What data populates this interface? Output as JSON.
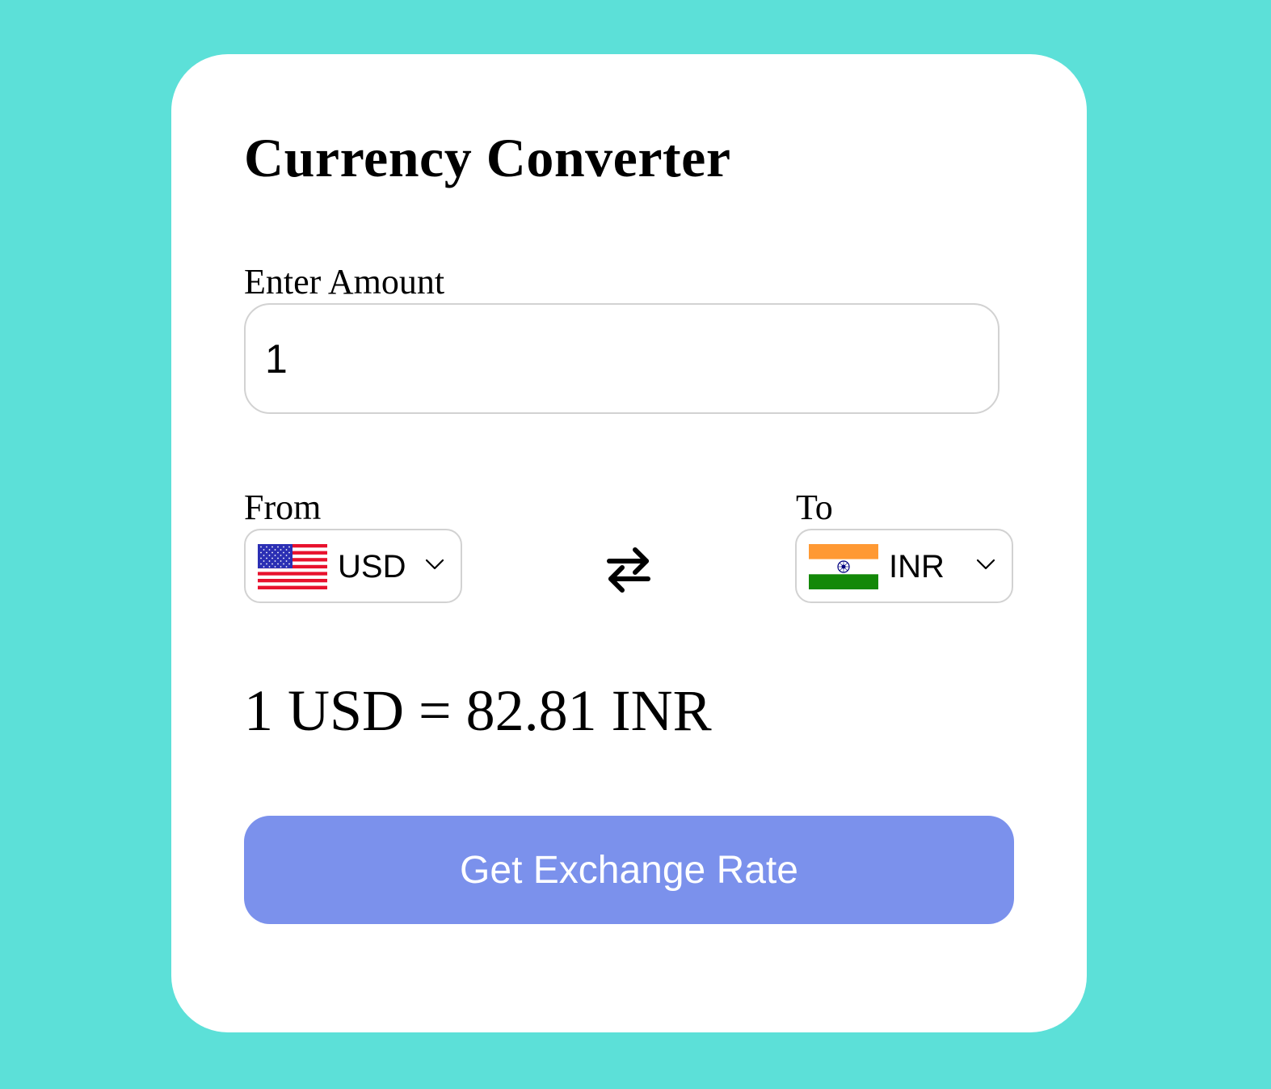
{
  "app": {
    "title": "Currency Converter"
  },
  "amount": {
    "label": "Enter Amount",
    "value": "1"
  },
  "from": {
    "label": "From",
    "currency": "USD",
    "flag_icon": "us-flag-icon"
  },
  "to": {
    "label": "To",
    "currency": "INR",
    "flag_icon": "india-flag-icon"
  },
  "swap": {
    "icon": "swap-arrows-icon"
  },
  "result": {
    "text": "1 USD = 82.81 INR"
  },
  "action": {
    "button_label": "Get Exchange Rate"
  },
  "colors": {
    "background": "#5ce0d8",
    "card": "#ffffff",
    "button": "#7b91ec",
    "border": "#d2d2d2"
  }
}
